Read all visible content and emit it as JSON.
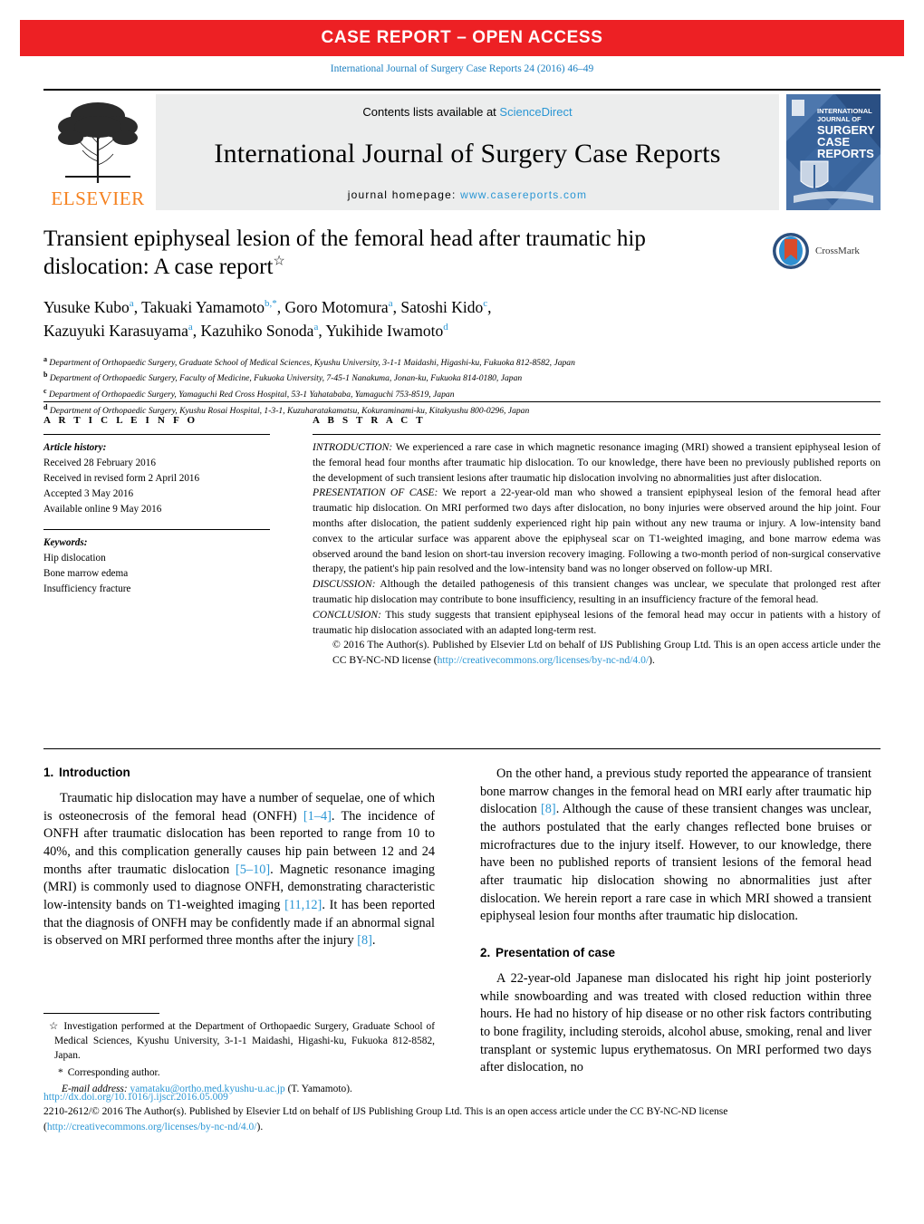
{
  "banner": {
    "text": "CASE REPORT – OPEN ACCESS"
  },
  "citation": {
    "text": "International Journal of Surgery Case Reports 24 (2016) 46–49"
  },
  "masthead": {
    "publisher": "ELSEVIER",
    "contents_prefix": "Contents lists available at ",
    "contents_link": "ScienceDirect",
    "journal_title": "International Journal of Surgery Case Reports",
    "homepage_prefix": "journal homepage: ",
    "homepage_url": "www.casereports.com",
    "cover": {
      "line1": "INTERNATIONAL",
      "line2": "JOURNAL OF",
      "line3": "SURGERY",
      "line4": "CASE",
      "line5": "REPORTS"
    }
  },
  "article": {
    "title": "Transient epiphyseal lesion of the femoral head after traumatic hip dislocation: A case report",
    "title_star": "☆",
    "crossmark_label": "CrossMark",
    "authors_line1": "Yusuke Kubo",
    "authors": [
      {
        "name": "Yusuke Kubo",
        "sup": "a",
        "sep": ", "
      },
      {
        "name": "Takuaki Yamamoto",
        "sup": "b,*",
        "sep": ", "
      },
      {
        "name": "Goro Motomura",
        "sup": "a",
        "sep": ", "
      },
      {
        "name": "Satoshi Kido",
        "sup": "c",
        "sep": ","
      },
      {
        "name": "Kazuyuki Karasuyama",
        "sup": "a",
        "sep": ", "
      },
      {
        "name": "Kazuhiko Sonoda",
        "sup": "a",
        "sep": ", "
      },
      {
        "name": "Yukihide Iwamoto",
        "sup": "d",
        "sep": ""
      }
    ],
    "affiliations": [
      {
        "mark": "a",
        "text": "Department of Orthopaedic Surgery, Graduate School of Medical Sciences, Kyushu University, 3-1-1 Maidashi, Higashi-ku, Fukuoka 812-8582, Japan"
      },
      {
        "mark": "b",
        "text": "Department of Orthopaedic Surgery, Faculty of Medicine, Fukuoka University, 7-45-1 Nanakuma, Jonan-ku, Fukuoka 814-0180, Japan"
      },
      {
        "mark": "c",
        "text": "Department of Orthopaedic Surgery, Yamaguchi Red Cross Hospital, 53-1 Yahatababa, Yamaguchi 753-8519, Japan"
      },
      {
        "mark": "d",
        "text": "Department of Orthopaedic Surgery, Kyushu Rosai Hospital, 1-3-1, Kuzuharatakamatsu, Kokuraminami-ku, Kitakyushu 800-0296, Japan"
      }
    ]
  },
  "article_info": {
    "heading": "A R T I C L E   I N F O",
    "history_label": "Article history:",
    "history": [
      "Received 28 February 2016",
      "Received in revised form 2 April 2016",
      "Accepted 3 May 2016",
      "Available online 9 May 2016"
    ],
    "keywords_label": "Keywords:",
    "keywords": [
      "Hip dislocation",
      "Bone marrow edema",
      "Insufficiency fracture"
    ]
  },
  "abstract": {
    "heading": "A B S T R A C T",
    "sections": [
      {
        "runhead": "INTRODUCTION:",
        "text": " We experienced a rare case in which magnetic resonance imaging (MRI) showed a transient epiphyseal lesion of the femoral head four months after traumatic hip dislocation. To our knowledge, there have been no previously published reports on the development of such transient lesions after traumatic hip dislocation involving no abnormalities just after dislocation."
      },
      {
        "runhead": "PRESENTATION OF CASE:",
        "text": " We report a 22-year-old man who showed a transient epiphyseal lesion of the femoral head after traumatic hip dislocation. On MRI performed two days after dislocation, no bony injuries were observed around the hip joint. Four months after dislocation, the patient suddenly experienced right hip pain without any new trauma or injury. A low-intensity band convex to the articular surface was apparent above the epiphyseal scar on T1-weighted imaging, and bone marrow edema was observed around the band lesion on short-tau inversion recovery imaging. Following a two-month period of non-surgical conservative therapy, the patient's hip pain resolved and the low-intensity band was no longer observed on follow-up MRI."
      },
      {
        "runhead": "DISCUSSION:",
        "text": " Although the detailed pathogenesis of this transient changes was unclear, we speculate that prolonged rest after traumatic hip dislocation may contribute to bone insufficiency, resulting in an insufficiency fracture of the femoral head."
      },
      {
        "runhead": "CONCLUSION:",
        "text": " This study suggests that transient epiphyseal lesions of the femoral head may occur in patients with a history of traumatic hip dislocation associated with an adapted long-term rest."
      }
    ],
    "copyright_pre": "© 2016 The Author(s). Published by Elsevier Ltd on behalf of IJS Publishing Group Ltd. This is an open access article under the CC BY-NC-ND license (",
    "copyright_link": "http://creativecommons.org/licenses/by-nc-nd/4.0/",
    "copyright_post": ")."
  },
  "body": {
    "left": {
      "section_number": "1.",
      "section_title": "Introduction",
      "paragraph_1_a": "Traumatic hip dislocation may have a number of sequelae, one of which is osteonecrosis of the femoral head (ONFH) ",
      "ref_1": "[1–4]",
      "paragraph_1_b": ". The incidence of ONFH after traumatic dislocation has been reported to range from 10 to 40%, and this complication generally causes hip pain between 12 and 24 months after traumatic dislocation ",
      "ref_2": "[5–10]",
      "paragraph_1_c": ". Magnetic resonance imaging (MRI) is commonly used to diagnose ONFH, demonstrating characteristic low-intensity bands on T1-weighted imaging ",
      "ref_3": "[11,12]",
      "paragraph_1_d": ". It has been reported that the diagnosis of ONFH may be confidently made if an abnormal signal is observed on MRI performed three months after the injury ",
      "ref_4": "[8]",
      "paragraph_1_e": "."
    },
    "right": {
      "paragraph_1_a": "On the other hand, a previous study reported the appearance of transient bone marrow changes in the femoral head on MRI early after traumatic hip dislocation ",
      "ref_1": "[8]",
      "paragraph_1_b": ". Although the cause of these transient changes was unclear, the authors postulated that the early changes reflected bone bruises or microfractures due to the injury itself. However, to our knowledge, there have been no published reports of transient lesions of the femoral head after traumatic hip dislocation showing no abnormalities just after dislocation. We herein report a rare case in which MRI showed a transient epiphyseal lesion four months after traumatic hip dislocation.",
      "section_number": "2.",
      "section_title": "Presentation of case",
      "paragraph_2": "A 22-year-old Japanese man dislocated his right hip joint posteriorly while snowboarding and was treated with closed reduction within three hours. He had no history of hip disease or no other risk factors contributing to bone fragility, including steroids, alcohol abuse, smoking, renal and liver transplant or systemic lupus erythematosus. On MRI performed two days after dislocation, no"
    }
  },
  "footnotes": {
    "star_mark": "☆",
    "star_text": "Investigation performed at the Department of Orthopaedic Surgery, Graduate School of Medical Sciences, Kyushu University, 3-1-1 Maidashi, Higashi-ku, Fukuoka 812-8582, Japan.",
    "corresponding_mark": "*",
    "corresponding_text": "Corresponding author.",
    "email_label": "E-mail address:",
    "email": "yamataku@ortho.med.kyushu-u.ac.jp",
    "email_owner": "(T. Yamamoto)."
  },
  "footer": {
    "doi": "http://dx.doi.org/10.1016/j.ijscr.2016.05.009",
    "issn_pre": "2210-2612/© 2016 The Author(s). Published by Elsevier Ltd on behalf of IJS Publishing Group Ltd. This is an open access article under the CC BY-NC-ND license (",
    "license_link": "http://creativecommons.org/licenses/by-nc-nd/4.0/",
    "issn_post": ")."
  },
  "colors": {
    "banner_red": "#ed2024",
    "link_blue": "#2a96d4",
    "elsevier_orange": "#f58220",
    "masthead_grey": "#eceded",
    "cover_blue": "#2c5d92"
  }
}
